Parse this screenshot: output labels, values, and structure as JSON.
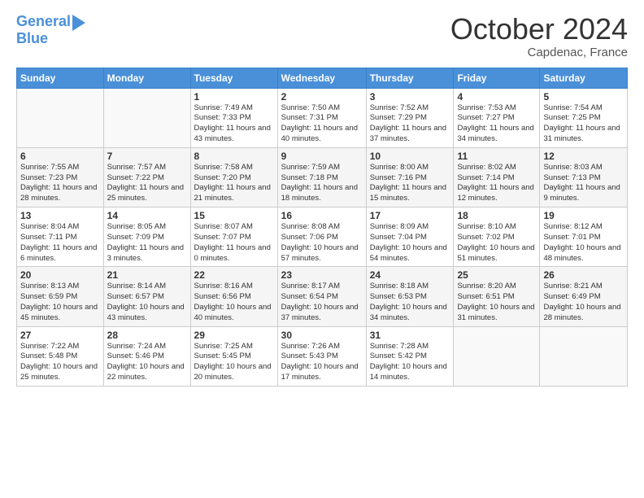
{
  "logo": {
    "line1": "General",
    "line2": "Blue"
  },
  "title": "October 2024",
  "location": "Capdenac, France",
  "days_of_week": [
    "Sunday",
    "Monday",
    "Tuesday",
    "Wednesday",
    "Thursday",
    "Friday",
    "Saturday"
  ],
  "weeks": [
    [
      {
        "day": "",
        "info": ""
      },
      {
        "day": "",
        "info": ""
      },
      {
        "day": "1",
        "info": "Sunrise: 7:49 AM\nSunset: 7:33 PM\nDaylight: 11 hours and 43 minutes."
      },
      {
        "day": "2",
        "info": "Sunrise: 7:50 AM\nSunset: 7:31 PM\nDaylight: 11 hours and 40 minutes."
      },
      {
        "day": "3",
        "info": "Sunrise: 7:52 AM\nSunset: 7:29 PM\nDaylight: 11 hours and 37 minutes."
      },
      {
        "day": "4",
        "info": "Sunrise: 7:53 AM\nSunset: 7:27 PM\nDaylight: 11 hours and 34 minutes."
      },
      {
        "day": "5",
        "info": "Sunrise: 7:54 AM\nSunset: 7:25 PM\nDaylight: 11 hours and 31 minutes."
      }
    ],
    [
      {
        "day": "6",
        "info": "Sunrise: 7:55 AM\nSunset: 7:23 PM\nDaylight: 11 hours and 28 minutes."
      },
      {
        "day": "7",
        "info": "Sunrise: 7:57 AM\nSunset: 7:22 PM\nDaylight: 11 hours and 25 minutes."
      },
      {
        "day": "8",
        "info": "Sunrise: 7:58 AM\nSunset: 7:20 PM\nDaylight: 11 hours and 21 minutes."
      },
      {
        "day": "9",
        "info": "Sunrise: 7:59 AM\nSunset: 7:18 PM\nDaylight: 11 hours and 18 minutes."
      },
      {
        "day": "10",
        "info": "Sunrise: 8:00 AM\nSunset: 7:16 PM\nDaylight: 11 hours and 15 minutes."
      },
      {
        "day": "11",
        "info": "Sunrise: 8:02 AM\nSunset: 7:14 PM\nDaylight: 11 hours and 12 minutes."
      },
      {
        "day": "12",
        "info": "Sunrise: 8:03 AM\nSunset: 7:13 PM\nDaylight: 11 hours and 9 minutes."
      }
    ],
    [
      {
        "day": "13",
        "info": "Sunrise: 8:04 AM\nSunset: 7:11 PM\nDaylight: 11 hours and 6 minutes."
      },
      {
        "day": "14",
        "info": "Sunrise: 8:05 AM\nSunset: 7:09 PM\nDaylight: 11 hours and 3 minutes."
      },
      {
        "day": "15",
        "info": "Sunrise: 8:07 AM\nSunset: 7:07 PM\nDaylight: 11 hours and 0 minutes."
      },
      {
        "day": "16",
        "info": "Sunrise: 8:08 AM\nSunset: 7:06 PM\nDaylight: 10 hours and 57 minutes."
      },
      {
        "day": "17",
        "info": "Sunrise: 8:09 AM\nSunset: 7:04 PM\nDaylight: 10 hours and 54 minutes."
      },
      {
        "day": "18",
        "info": "Sunrise: 8:10 AM\nSunset: 7:02 PM\nDaylight: 10 hours and 51 minutes."
      },
      {
        "day": "19",
        "info": "Sunrise: 8:12 AM\nSunset: 7:01 PM\nDaylight: 10 hours and 48 minutes."
      }
    ],
    [
      {
        "day": "20",
        "info": "Sunrise: 8:13 AM\nSunset: 6:59 PM\nDaylight: 10 hours and 45 minutes."
      },
      {
        "day": "21",
        "info": "Sunrise: 8:14 AM\nSunset: 6:57 PM\nDaylight: 10 hours and 43 minutes."
      },
      {
        "day": "22",
        "info": "Sunrise: 8:16 AM\nSunset: 6:56 PM\nDaylight: 10 hours and 40 minutes."
      },
      {
        "day": "23",
        "info": "Sunrise: 8:17 AM\nSunset: 6:54 PM\nDaylight: 10 hours and 37 minutes."
      },
      {
        "day": "24",
        "info": "Sunrise: 8:18 AM\nSunset: 6:53 PM\nDaylight: 10 hours and 34 minutes."
      },
      {
        "day": "25",
        "info": "Sunrise: 8:20 AM\nSunset: 6:51 PM\nDaylight: 10 hours and 31 minutes."
      },
      {
        "day": "26",
        "info": "Sunrise: 8:21 AM\nSunset: 6:49 PM\nDaylight: 10 hours and 28 minutes."
      }
    ],
    [
      {
        "day": "27",
        "info": "Sunrise: 7:22 AM\nSunset: 5:48 PM\nDaylight: 10 hours and 25 minutes."
      },
      {
        "day": "28",
        "info": "Sunrise: 7:24 AM\nSunset: 5:46 PM\nDaylight: 10 hours and 22 minutes."
      },
      {
        "day": "29",
        "info": "Sunrise: 7:25 AM\nSunset: 5:45 PM\nDaylight: 10 hours and 20 minutes."
      },
      {
        "day": "30",
        "info": "Sunrise: 7:26 AM\nSunset: 5:43 PM\nDaylight: 10 hours and 17 minutes."
      },
      {
        "day": "31",
        "info": "Sunrise: 7:28 AM\nSunset: 5:42 PM\nDaylight: 10 hours and 14 minutes."
      },
      {
        "day": "",
        "info": ""
      },
      {
        "day": "",
        "info": ""
      }
    ]
  ]
}
